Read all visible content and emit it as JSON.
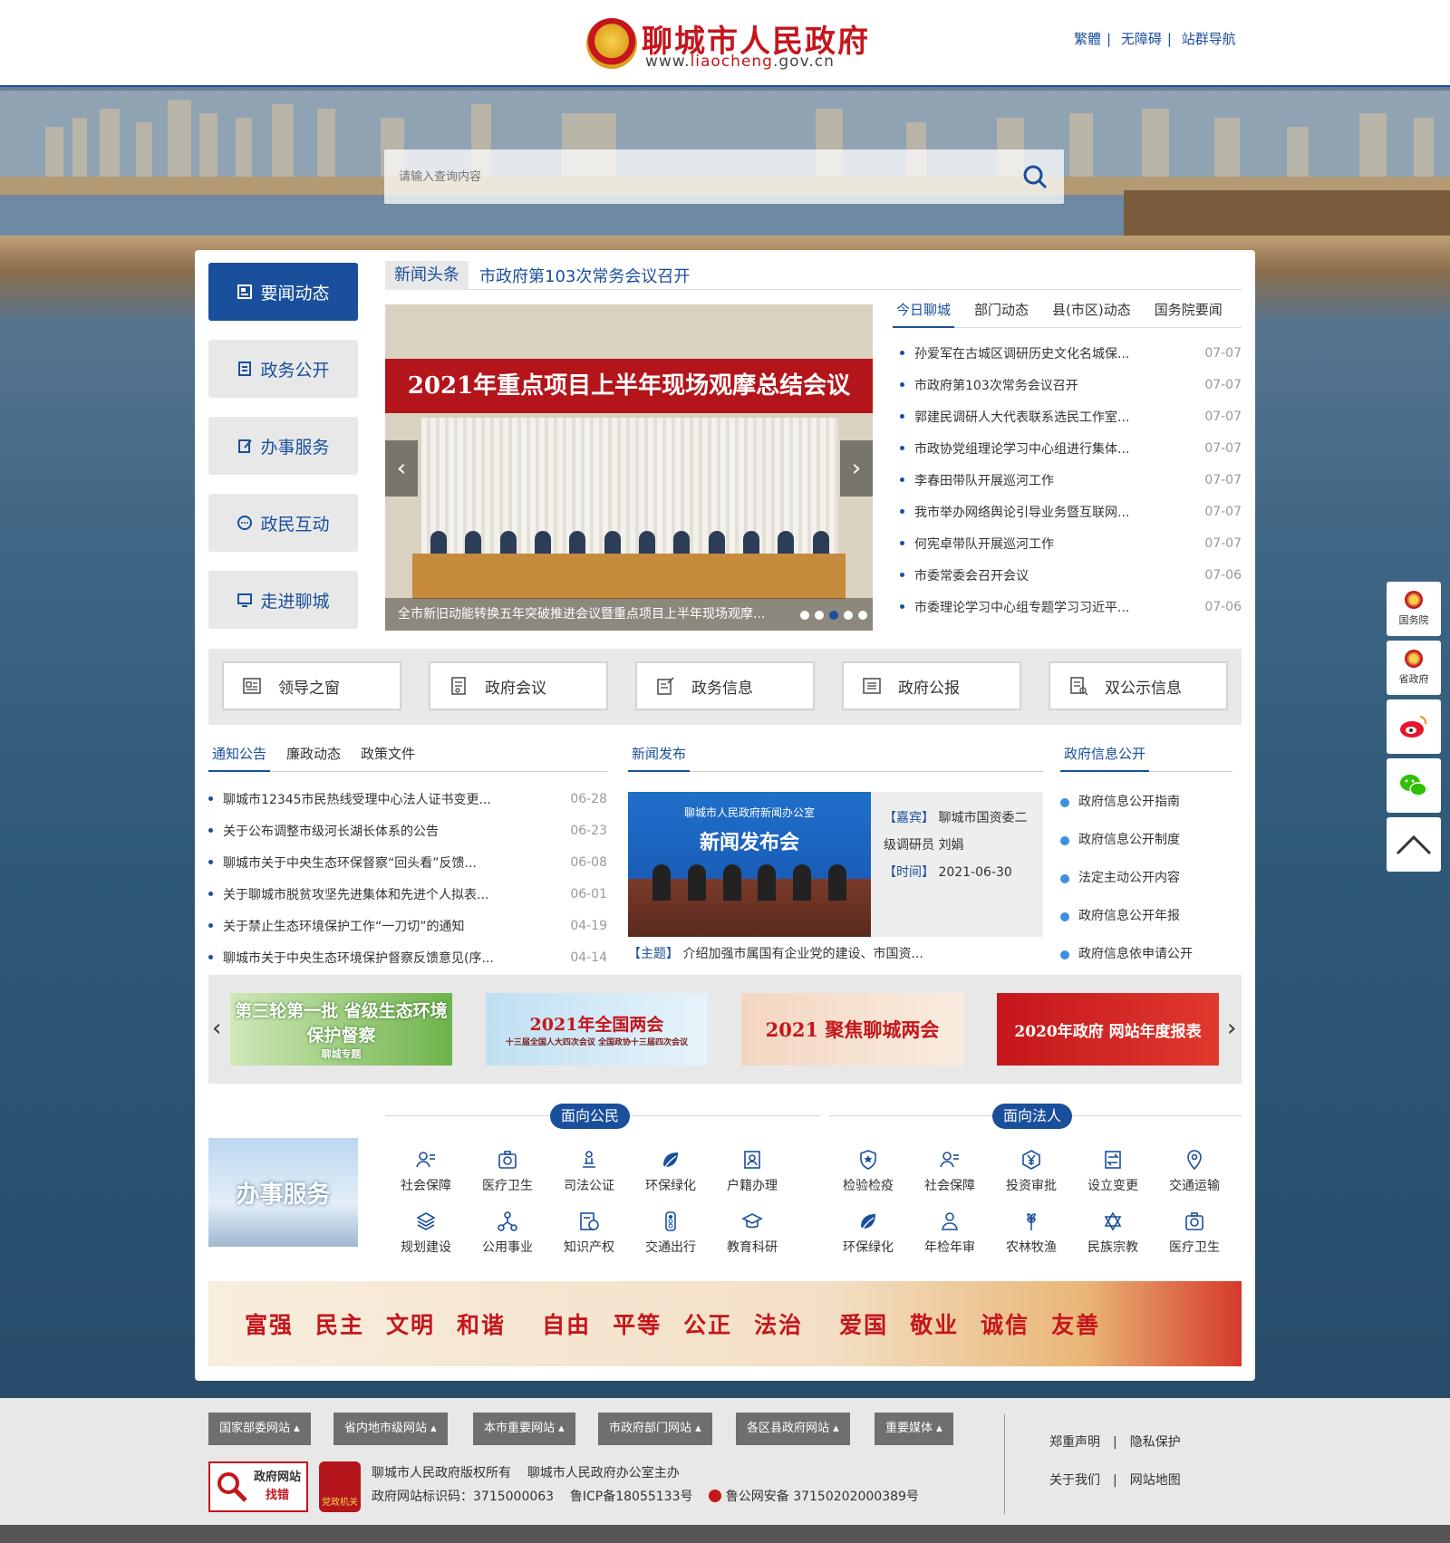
{
  "header": {
    "site_title": "聊城市人民政府",
    "site_url_prefix": "www.",
    "site_url_brand": "liaocheng",
    "site_url_suffix": ".gov.cn",
    "links": [
      "繁體",
      "无障碍",
      "站群导航"
    ],
    "separator": "|"
  },
  "search": {
    "placeholder": "请输入查询内容"
  },
  "sidenav": [
    {
      "label": "要闻动态",
      "icon": "news-icon",
      "active": true
    },
    {
      "label": "政务公开",
      "icon": "document-icon",
      "active": false
    },
    {
      "label": "办事服务",
      "icon": "edit-icon",
      "active": false
    },
    {
      "label": "政民互动",
      "icon": "chat-icon",
      "active": false
    },
    {
      "label": "走进聊城",
      "icon": "monitor-icon",
      "active": false
    }
  ],
  "headline": {
    "tag": "新闻头条",
    "text": "市政府第103次常务会议召开"
  },
  "slider": {
    "banner_text": "2021年重点项目上半年现场观摩总结会议",
    "caption": "全市新旧动能转换五年突破推进会议暨重点项目上半年现场观摩...",
    "prev": "‹",
    "next": "›",
    "active_dot": 3,
    "dot_count": 5
  },
  "news_tabs": [
    "今日聊城",
    "部门动态",
    "县(市区)动态",
    "国务院要闻"
  ],
  "news": [
    {
      "title": "孙爱军在古城区调研历史文化名城保...",
      "date": "07-07"
    },
    {
      "title": "市政府第103次常务会议召开",
      "date": "07-07"
    },
    {
      "title": "郭建民调研人大代表联系选民工作室...",
      "date": "07-07"
    },
    {
      "title": "市政协党组理论学习中心组进行集体...",
      "date": "07-07"
    },
    {
      "title": "李春田带队开展巡河工作",
      "date": "07-07"
    },
    {
      "title": "我市举办网络舆论引导业务暨互联网...",
      "date": "07-07"
    },
    {
      "title": "何宪卓带队开展巡河工作",
      "date": "07-07"
    },
    {
      "title": "市委常委会召开会议",
      "date": "07-06"
    },
    {
      "title": "市委理论学习中心组专题学习习近平...",
      "date": "07-06"
    }
  ],
  "quick_links": [
    {
      "label": "领导之窗",
      "icon": "leader-icon"
    },
    {
      "label": "政府会议",
      "icon": "meeting-icon"
    },
    {
      "label": "政务信息",
      "icon": "info-icon"
    },
    {
      "label": "政府公报",
      "icon": "bulletin-icon"
    },
    {
      "label": "双公示信息",
      "icon": "publicity-icon"
    }
  ],
  "notice_tabs": [
    "通知公告",
    "廉政动态",
    "政策文件"
  ],
  "notices": [
    {
      "title": "聊城市12345市民热线受理中心法人证书变更...",
      "date": "06-28"
    },
    {
      "title": "关于公布调整市级河长湖长体系的公告",
      "date": "06-23"
    },
    {
      "title": "聊城市关于中央生态环保督察“回头看”反馈...",
      "date": "06-08"
    },
    {
      "title": "关于聊城市脱贫攻坚先进集体和先进个人拟表...",
      "date": "06-01"
    },
    {
      "title": "关于禁止生态环境保护工作“一刀切”的通知",
      "date": "04-19"
    },
    {
      "title": "聊城市关于中央生态环境保护督察反馈意见(序...",
      "date": "04-14"
    }
  ],
  "press": {
    "tab": "新闻发布",
    "img_line1": "聊城市人民政府新闻办公室",
    "img_line2": "新闻发布会",
    "guest_label": "【嘉宾】",
    "guest": "聊城市国资委二级调研员 刘娟",
    "time_label": "【时间】",
    "time": "2021-06-30",
    "topic_label": "【主题】",
    "topic": "介绍加强市属国有企业党的建设、市国资..."
  },
  "info_open": {
    "tab": "政府信息公开",
    "items": [
      "政府信息公开指南",
      "政府信息公开制度",
      "法定主动公开内容",
      "政府信息公开年报",
      "政府信息依申请公开"
    ]
  },
  "banners": [
    {
      "text": "第三轮第一批 省级生态环境保护督察",
      "tag": "聊城专题"
    },
    {
      "text": "2021年全国两会",
      "tag": "十三届全国人大四次会议 全国政协十三届四次会议"
    },
    {
      "text": "2021 聚焦聊城两会",
      "tag": ""
    },
    {
      "text": "2020年政府 网站年度报表",
      "tag": ""
    }
  ],
  "services": {
    "image_text": "办事服务",
    "citizen_title": "面向公民",
    "citizen": [
      {
        "label": "社会保障",
        "icon": "social-security-icon"
      },
      {
        "label": "医疗卫生",
        "icon": "medical-icon"
      },
      {
        "label": "司法公证",
        "icon": "justice-icon"
      },
      {
        "label": "环保绿化",
        "icon": "leaf-icon"
      },
      {
        "label": "户籍办理",
        "icon": "household-icon"
      },
      {
        "label": "规划建设",
        "icon": "layers-icon"
      },
      {
        "label": "公用事业",
        "icon": "network-icon"
      },
      {
        "label": "知识产权",
        "icon": "copyright-icon"
      },
      {
        "label": "交通出行",
        "icon": "traffic-icon"
      },
      {
        "label": "教育科研",
        "icon": "graduation-icon"
      }
    ],
    "legal_title": "面向法人",
    "legal": [
      {
        "label": "检验检疫",
        "icon": "shield-star-icon"
      },
      {
        "label": "社会保障",
        "icon": "social-security-icon"
      },
      {
        "label": "投资审批",
        "icon": "yen-icon"
      },
      {
        "label": "设立变更",
        "icon": "change-icon"
      },
      {
        "label": "交通运输",
        "icon": "location-icon"
      },
      {
        "label": "环保绿化",
        "icon": "leaf-icon"
      },
      {
        "label": "年检年审",
        "icon": "inspector-icon"
      },
      {
        "label": "农林牧渔",
        "icon": "wheat-icon"
      },
      {
        "label": "民族宗教",
        "icon": "star-of-david-icon"
      },
      {
        "label": "医疗卫生",
        "icon": "medical-icon"
      }
    ]
  },
  "values": [
    "富强",
    "民主",
    "文明",
    "和谐",
    "自由",
    "平等",
    "公正",
    "法治",
    "爱国",
    "敬业",
    "诚信",
    "友善"
  ],
  "floatbar": [
    {
      "label": "国务院",
      "icon": "emblem-icon"
    },
    {
      "label": "省政府",
      "icon": "emblem-icon"
    },
    {
      "label": "",
      "icon": "weibo-icon"
    },
    {
      "label": "",
      "icon": "wechat-icon"
    },
    {
      "label": "",
      "icon": "back-to-top-icon"
    }
  ],
  "footer": {
    "menus": [
      "国家部委网站",
      "省内地市级网站",
      "本市重要网站",
      "市政府部门网站",
      "各区县政府网站",
      "重要媒体"
    ],
    "find_error_line1": "政府网站",
    "find_error_line2": "找错",
    "badge_text": "党政机关",
    "copyright": "聊城市人民政府版权所有",
    "organizer": "聊城市人民政府办公室主办",
    "site_id": "政府网站标识码：3715000063",
    "icp": "鲁ICP备18055133号",
    "police": "鲁公网安备 37150202000389号",
    "links": [
      "郑重声明",
      "隐私保护",
      "关于我们",
      "网站地图"
    ],
    "separator": "|"
  },
  "colors": {
    "primary": "#1a4f9c",
    "red": "#c4161c",
    "gray_bg": "#e8e8e8"
  }
}
